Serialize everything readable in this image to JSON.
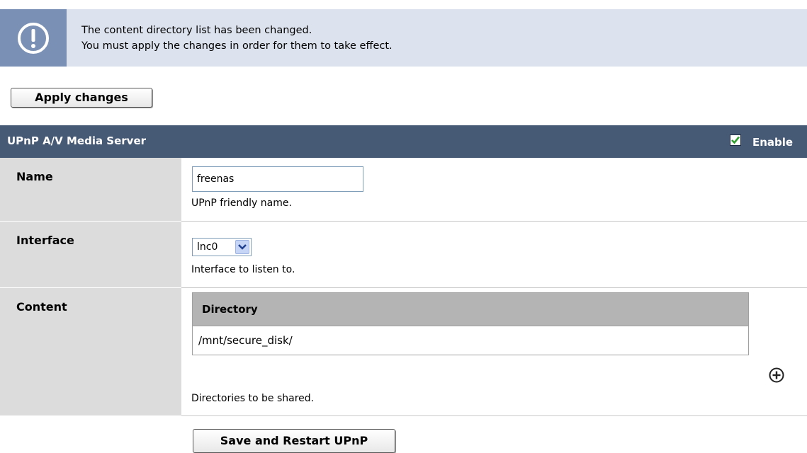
{
  "notice": {
    "line1": "The content directory list has been changed.",
    "line2": "You must apply the changes in order for them to take effect.",
    "icon": "exclamation-icon"
  },
  "apply_button_label": "Apply changes",
  "panel": {
    "title": "UPnP A/V Media Server",
    "enable_label": "Enable",
    "enable_checked": true
  },
  "name_row": {
    "label": "Name",
    "value": "freenas",
    "hint": "UPnP friendly name."
  },
  "interface_row": {
    "label": "Interface",
    "selected": "lnc0",
    "hint": "Interface to listen to."
  },
  "content_row": {
    "label": "Content",
    "column_header": "Directory",
    "directories": [
      "/mnt/secure_disk/"
    ],
    "hint": "Directories to be shared.",
    "add_icon": "plus-circle-icon"
  },
  "save_button_label": "Save and Restart UPnP",
  "colors": {
    "header_bg": "#475a75",
    "notice_bg": "#dde3ee",
    "label_bg": "#dcdcdc",
    "checkmark": "#2f9e2f"
  }
}
